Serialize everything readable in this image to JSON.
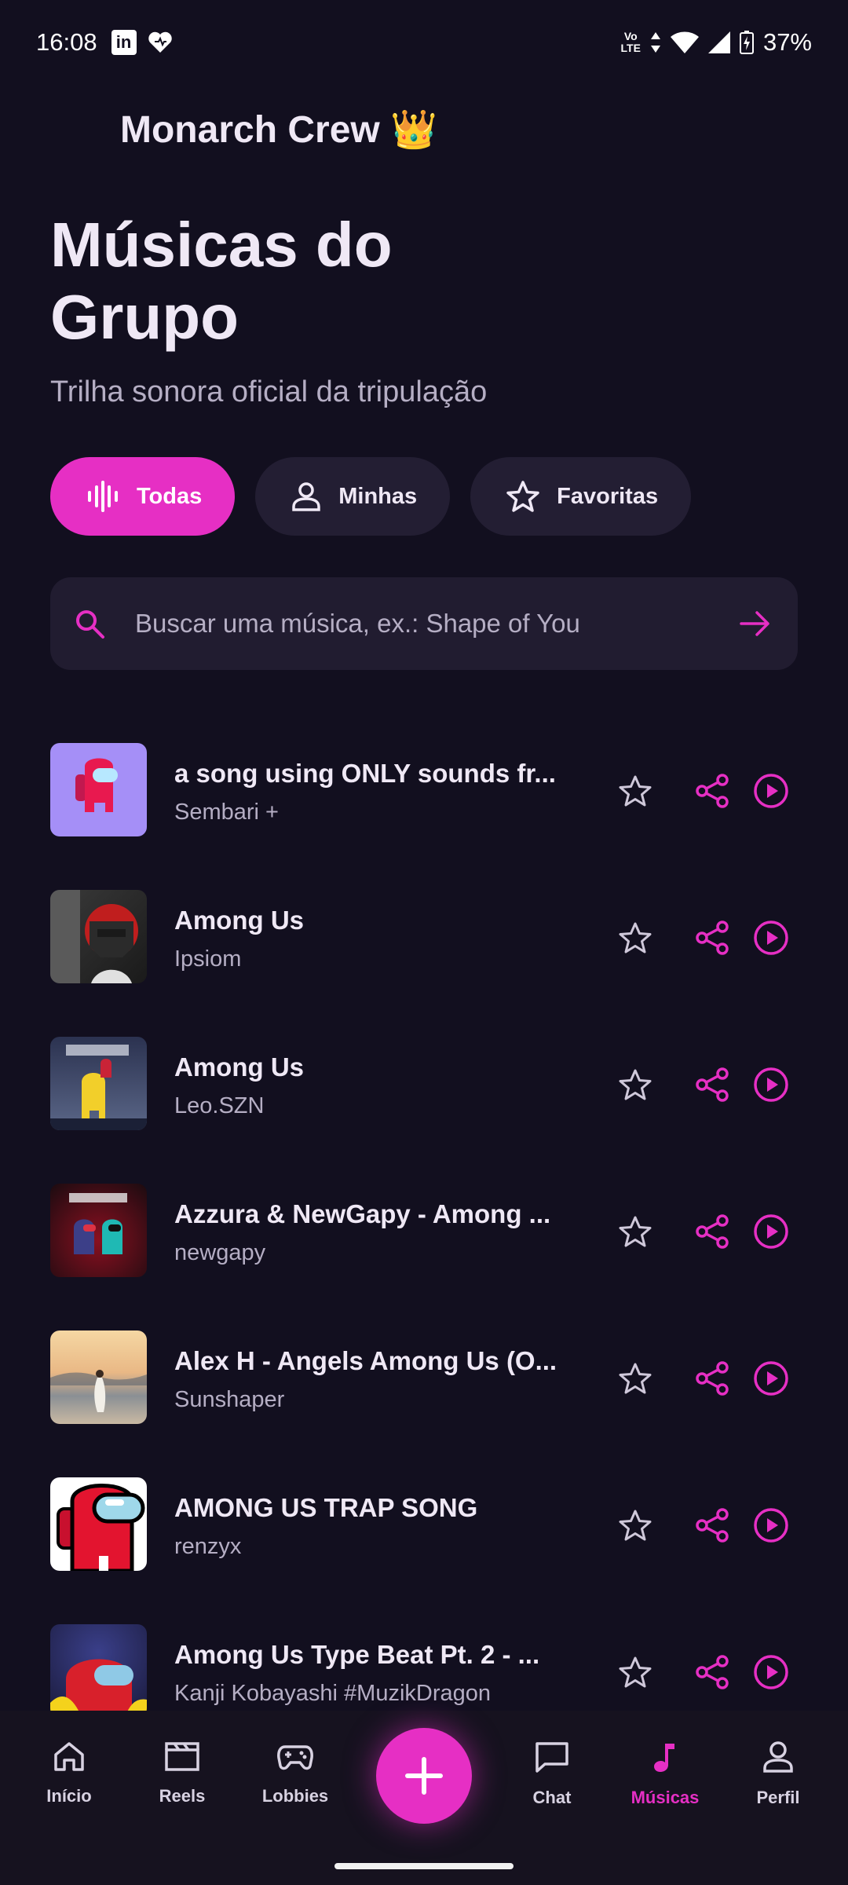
{
  "status_bar": {
    "time": "16:08",
    "left_icons": [
      "linkedin-icon",
      "heart-app-icon"
    ],
    "volte_top": "Vo",
    "volte_bottom": "LTE",
    "battery": "37%"
  },
  "header": {
    "app_title": "Monarch Crew 👑",
    "page_title": "Músicas do Grupo",
    "page_subtitle": "Trilha sonora oficial da tripulação"
  },
  "filters": [
    {
      "label": "Todas",
      "icon": "waveform-icon",
      "active": true
    },
    {
      "label": "Minhas",
      "icon": "person-icon",
      "active": false
    },
    {
      "label": "Favoritas",
      "icon": "star-icon",
      "active": false
    }
  ],
  "search": {
    "placeholder": "Buscar uma música, ex.: Shape of You"
  },
  "songs": [
    {
      "title": "a song using ONLY sounds fr...",
      "artist": "Sembari +"
    },
    {
      "title": "Among Us",
      "artist": "Ipsiom"
    },
    {
      "title": "Among Us",
      "artist": "Leo.SZN"
    },
    {
      "title": "Azzura & NewGapy - Among ...",
      "artist": "newgapy"
    },
    {
      "title": "Alex H - Angels Among Us (O...",
      "artist": "Sunshaper"
    },
    {
      "title": "AMONG US TRAP SONG",
      "artist": "renzyx"
    },
    {
      "title": "Among Us Type Beat Pt. 2 - ...",
      "artist": "Kanji Kobayashi #MuzikDragon"
    }
  ],
  "bottom_nav": [
    {
      "label": "Início",
      "icon": "home-icon",
      "active": false
    },
    {
      "label": "Reels",
      "icon": "clapperboard-icon",
      "active": false
    },
    {
      "label": "Lobbies",
      "icon": "gamepad-icon",
      "active": false
    },
    {
      "label": "Chat",
      "icon": "chat-bubble-icon",
      "active": false
    },
    {
      "label": "Músicas",
      "icon": "music-note-icon",
      "active": true
    },
    {
      "label": "Perfil",
      "icon": "person-icon",
      "active": false
    }
  ],
  "colors": {
    "accent": "#e62fc4",
    "background": "#120f1f",
    "surface": "#231e33",
    "text_primary": "#efe8f5",
    "text_secondary": "#b5aec4"
  }
}
